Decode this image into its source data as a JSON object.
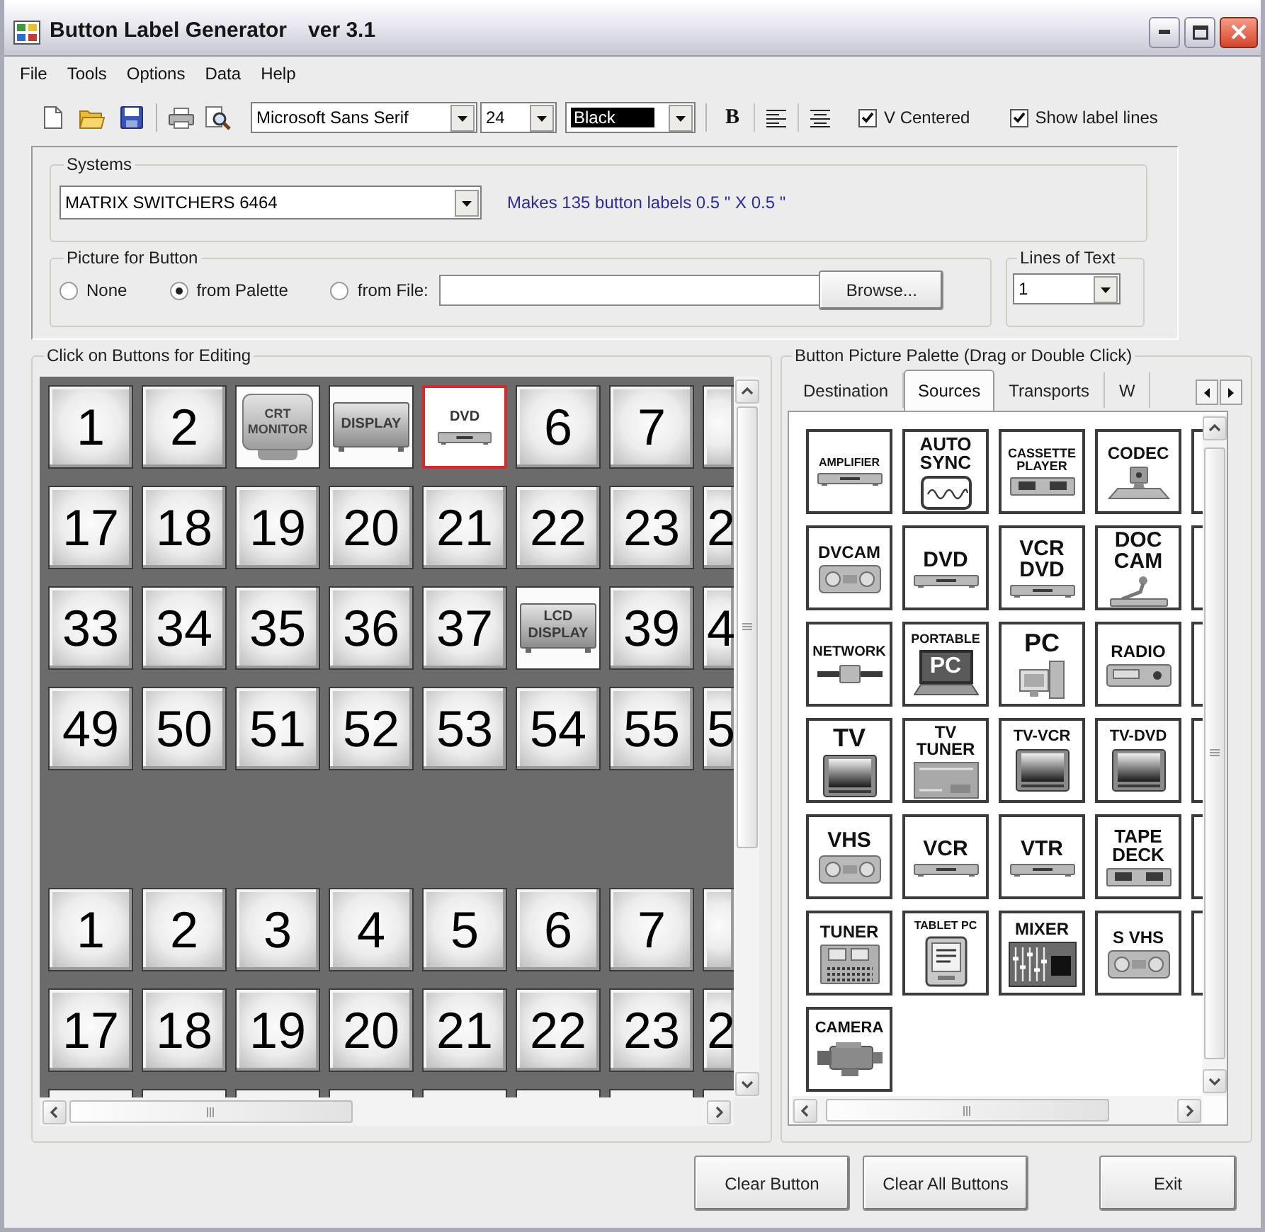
{
  "window": {
    "title": "Button Label Generator",
    "version": "ver 3.1"
  },
  "menu": [
    "File",
    "Tools",
    "Options",
    "Data",
    "Help"
  ],
  "toolbar": {
    "font": "Microsoft Sans Serif",
    "size": "24",
    "ink": "Black",
    "bold": "B",
    "checks": [
      {
        "label": "V Centered",
        "checked": true
      },
      {
        "label": "Show label lines",
        "checked": true
      }
    ]
  },
  "systems": {
    "legend": "Systems",
    "value": "MATRIX SWITCHERS 6464",
    "info": "Makes 135 button labels 0.5 \" X 0.5 \""
  },
  "picture": {
    "legend": "Picture for Button",
    "options": [
      {
        "label": "None",
        "selected": false
      },
      {
        "label": "from Palette",
        "selected": true
      },
      {
        "label": "from File:",
        "selected": false
      }
    ],
    "browse": "Browse..."
  },
  "lines_of_text": {
    "legend": "Lines of Text",
    "value": "1"
  },
  "editor": {
    "legend": "Click on Buttons for Editing",
    "sections": [
      {
        "rows": [
          [
            {
              "kind": "number",
              "label": "1",
              "selected": false
            },
            {
              "kind": "number",
              "label": "2",
              "selected": false
            },
            {
              "kind": "monitor",
              "label": "CRT\nMONITOR",
              "selected": false
            },
            {
              "kind": "display",
              "label": "DISPLAY",
              "selected": false
            },
            {
              "kind": "deck",
              "label": "DVD",
              "selected": true
            },
            {
              "kind": "number",
              "label": "6",
              "selected": false
            },
            {
              "kind": "number",
              "label": "7",
              "selected": false
            },
            {
              "kind": "edge",
              "selected": false
            }
          ],
          [
            {
              "kind": "number",
              "label": "17",
              "selected": false
            },
            {
              "kind": "number",
              "label": "18",
              "selected": false
            },
            {
              "kind": "number",
              "label": "19",
              "selected": false
            },
            {
              "kind": "number",
              "label": "20",
              "selected": false
            },
            {
              "kind": "number",
              "label": "21",
              "selected": false
            },
            {
              "kind": "number",
              "label": "22",
              "selected": false
            },
            {
              "kind": "number",
              "label": "23",
              "selected": false
            },
            {
              "kind": "edge",
              "label": "2",
              "selected": false
            }
          ],
          [
            {
              "kind": "number",
              "label": "33",
              "selected": false
            },
            {
              "kind": "number",
              "label": "34",
              "selected": false
            },
            {
              "kind": "number",
              "label": "35",
              "selected": false
            },
            {
              "kind": "number",
              "label": "36",
              "selected": false
            },
            {
              "kind": "number",
              "label": "37",
              "selected": false
            },
            {
              "kind": "display",
              "label": "LCD\nDISPLAY",
              "selected": false
            },
            {
              "kind": "number",
              "label": "39",
              "selected": false
            },
            {
              "kind": "edge",
              "label": "4",
              "selected": false
            }
          ],
          [
            {
              "kind": "number",
              "label": "49",
              "selected": false
            },
            {
              "kind": "number",
              "label": "50",
              "selected": false
            },
            {
              "kind": "number",
              "label": "51",
              "selected": false
            },
            {
              "kind": "number",
              "label": "52",
              "selected": false
            },
            {
              "kind": "number",
              "label": "53",
              "selected": false
            },
            {
              "kind": "number",
              "label": "54",
              "selected": false
            },
            {
              "kind": "number",
              "label": "55",
              "selected": false
            },
            {
              "kind": "edge",
              "label": "5",
              "selected": false
            }
          ]
        ]
      },
      {
        "rows": [
          [
            {
              "kind": "number",
              "label": "1",
              "selected": false
            },
            {
              "kind": "number",
              "label": "2",
              "selected": false
            },
            {
              "kind": "number",
              "label": "3",
              "selected": false
            },
            {
              "kind": "number",
              "label": "4",
              "selected": false
            },
            {
              "kind": "number",
              "label": "5",
              "selected": false
            },
            {
              "kind": "number",
              "label": "6",
              "selected": false
            },
            {
              "kind": "number",
              "label": "7",
              "selected": false
            },
            {
              "kind": "edge",
              "selected": false
            }
          ],
          [
            {
              "kind": "number",
              "label": "17",
              "selected": false
            },
            {
              "kind": "number",
              "label": "18",
              "selected": false
            },
            {
              "kind": "number",
              "label": "19",
              "selected": false
            },
            {
              "kind": "number",
              "label": "20",
              "selected": false
            },
            {
              "kind": "number",
              "label": "21",
              "selected": false
            },
            {
              "kind": "number",
              "label": "22",
              "selected": false
            },
            {
              "kind": "number",
              "label": "23",
              "selected": false
            },
            {
              "kind": "edge",
              "label": "2",
              "selected": false
            }
          ],
          [
            {
              "kind": "peek",
              "selected": false
            },
            {
              "kind": "peek",
              "selected": false
            },
            {
              "kind": "peek",
              "selected": false
            },
            {
              "kind": "peek",
              "selected": false
            },
            {
              "kind": "peek",
              "selected": false
            },
            {
              "kind": "peek",
              "selected": false
            },
            {
              "kind": "peek",
              "selected": false
            },
            {
              "kind": "corner",
              "selected": false
            }
          ]
        ]
      }
    ]
  },
  "palette": {
    "legend": "Button Picture Palette (Drag or Double Click)",
    "tabs": [
      {
        "label": "Destination",
        "selected": false
      },
      {
        "label": "Sources",
        "selected": true
      },
      {
        "label": "Transports",
        "selected": false
      },
      {
        "label": "W",
        "selected": false
      }
    ],
    "rows": [
      [
        {
          "label": "AMPLIFIER",
          "kind": "deck"
        },
        {
          "label": "AUTO\nSYNC",
          "kind": "wave"
        },
        {
          "label": "CASSETTE\nPLAYER",
          "kind": "cassette"
        },
        {
          "label": "CODEC",
          "kind": "codec"
        },
        {
          "kind": "cut"
        }
      ],
      [
        {
          "label": "DVCAM",
          "kind": "tape"
        },
        {
          "label": "DVD",
          "kind": "deck"
        },
        {
          "label": "VCR\nDVD",
          "kind": "deck"
        },
        {
          "label": "DOC\nCAM",
          "kind": "doccam"
        },
        {
          "kind": "cut"
        }
      ],
      [
        {
          "label": "NETWORK",
          "kind": "network"
        },
        {
          "label": "PORTABLE",
          "kind": "laptop",
          "screen": "PC"
        },
        {
          "label": "PC",
          "kind": "computer"
        },
        {
          "label": "RADIO",
          "kind": "radio"
        },
        {
          "kind": "cut"
        }
      ],
      [
        {
          "label": "TV",
          "kind": "tv"
        },
        {
          "label": "TV\nTUNER",
          "kind": "tuner"
        },
        {
          "label": "TV-VCR",
          "kind": "tv"
        },
        {
          "label": "TV-DVD",
          "kind": "tv"
        },
        {
          "kind": "cut"
        }
      ],
      [
        {
          "label": "VHS",
          "kind": "tape"
        },
        {
          "label": "VCR",
          "kind": "deck"
        },
        {
          "label": "VTR",
          "kind": "deck"
        },
        {
          "label": "TAPE\nDECK",
          "kind": "cassette"
        },
        {
          "kind": "cut"
        }
      ],
      [
        {
          "label": "TUNER",
          "kind": "keypad"
        },
        {
          "label": "TABLET PC",
          "kind": "tablet"
        },
        {
          "label": "MIXER",
          "kind": "mixer"
        },
        {
          "label": "S VHS",
          "kind": "tape"
        },
        {
          "kind": "cut"
        }
      ],
      [
        {
          "label": "CAMERA",
          "kind": "camcorder"
        }
      ]
    ]
  },
  "buttons": [
    "Clear Button",
    "Clear All Buttons",
    "Exit"
  ]
}
